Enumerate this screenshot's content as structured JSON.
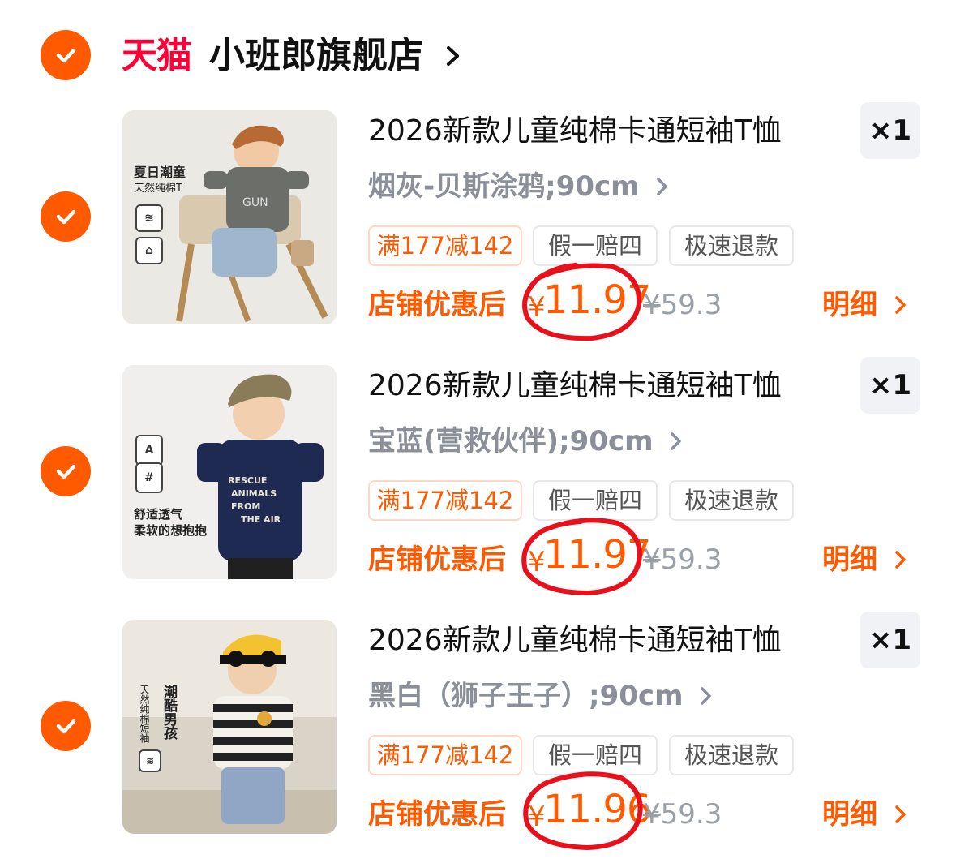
{
  "store": {
    "badge": "天猫",
    "name": "小班郎旗舰店",
    "checked": true
  },
  "colors": {
    "accent": "#ff5a00",
    "tmall_red": "#ff0036",
    "circle_red": "#e8101a"
  },
  "items": [
    {
      "title": "2026新款儿童纯棉卡通短袖T恤",
      "quantity": "×1",
      "variant": "烟灰-贝斯涂鸦;90cm",
      "tags": [
        "满177减142",
        "假一赔四",
        "极速退款"
      ],
      "price_label": "店铺优惠后",
      "currency": "¥",
      "price": "11.97",
      "original_price": "59.3",
      "original_currency": "¥",
      "detail_label": "明细",
      "thumb": {
        "texts": [
          "夏日潮童",
          "天然纯棉T"
        ],
        "shirt_color": "#6b6e69",
        "background": "#ebe9e4"
      }
    },
    {
      "title": "2026新款儿童纯棉卡通短袖T恤",
      "quantity": "×1",
      "variant": "宝蓝(营救伙伴);90cm",
      "tags": [
        "满177减142",
        "假一赔四",
        "极速退款"
      ],
      "price_label": "店铺优惠后",
      "currency": "¥",
      "price": "11.97",
      "original_price": "59.3",
      "original_currency": "¥",
      "detail_label": "明细",
      "thumb": {
        "texts": [
          "舒适透气",
          "柔软的想抱抱"
        ],
        "shirt_text": "RESCUE ANIMALS FROM THE AIR",
        "shirt_color": "#1f2a52",
        "background": "#f0efee"
      }
    },
    {
      "title": "2026新款儿童纯棉卡通短袖T恤",
      "quantity": "×1",
      "variant": "黑白（狮子王子）;90cm",
      "tags": [
        "满177减142",
        "假一赔四",
        "极速退款"
      ],
      "price_label": "店铺优惠后",
      "currency": "¥",
      "price": "11.96",
      "original_price": "59.3",
      "original_currency": "¥",
      "detail_label": "明细",
      "thumb": {
        "texts": [
          "潮酷男孩",
          "天然纯棉短袖"
        ],
        "shirt_color": "#222222",
        "background": "#ece7df"
      }
    }
  ]
}
